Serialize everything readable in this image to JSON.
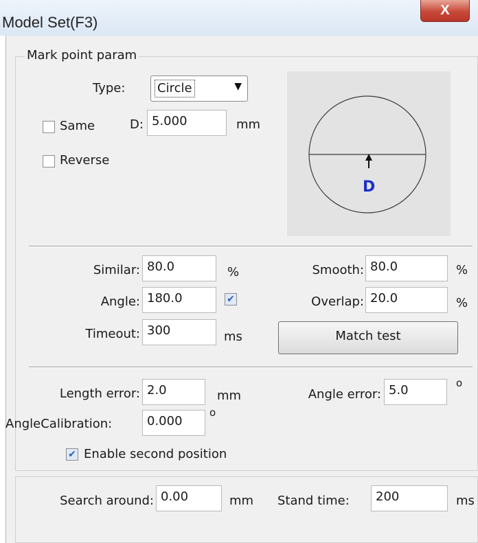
{
  "window": {
    "title": "Model Set(F3)",
    "close_label": "X"
  },
  "mark_point": {
    "group_label": "Mark point param",
    "type_label": "Type:",
    "type_value": "Circle",
    "same_label": "Same",
    "same_checked": false,
    "d_label": "D:",
    "d_value": "5.000",
    "d_unit": "mm",
    "reverse_label": "Reverse",
    "reverse_checked": false,
    "preview_label": "D"
  },
  "matching": {
    "similar_label": "Similar:",
    "similar_value": "80.0",
    "similar_unit": "%",
    "smooth_label": "Smooth:",
    "smooth_value": "80.0",
    "smooth_unit": "%",
    "angle_label": "Angle:",
    "angle_value": "180.0",
    "angle_checked": true,
    "overlap_label": "Overlap:",
    "overlap_value": "20.0",
    "overlap_unit": "%",
    "timeout_label": "Timeout:",
    "timeout_value": "300",
    "timeout_unit": "ms",
    "match_test_label": "Match test"
  },
  "errors": {
    "length_error_label": "Length error:",
    "length_error_value": "2.0",
    "length_error_unit": "mm",
    "angle_error_label": "Angle error:",
    "angle_error_value": "5.0",
    "angle_error_unit": "o",
    "angle_calibration_label": "AngleCalibration:",
    "angle_calibration_value": "0.000",
    "angle_calibration_unit": "o",
    "enable_second_label": "Enable second position",
    "enable_second_checked": true
  },
  "search": {
    "search_around_label": "Search around:",
    "search_around_value": "0.00",
    "search_around_unit": "mm",
    "stand_time_label": "Stand time:",
    "stand_time_value": "200",
    "stand_time_unit": "ms"
  }
}
